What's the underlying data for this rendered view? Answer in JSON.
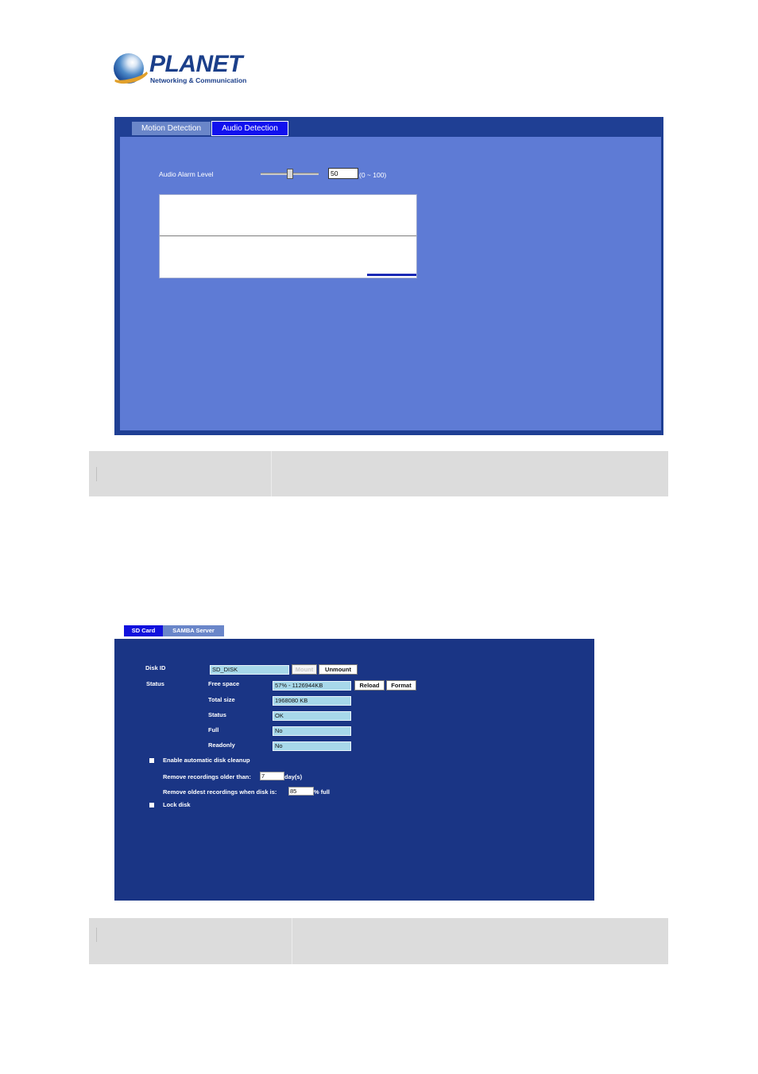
{
  "logo": {
    "brand": "PLANET",
    "tagline": "Networking & Communication"
  },
  "audio_panel": {
    "tabs": [
      {
        "label": "Motion Detection",
        "selected": false
      },
      {
        "label": "Audio Detection",
        "selected": true
      }
    ],
    "alarm_level_label": "Audio Alarm Level",
    "alarm_level_value": "50",
    "alarm_level_range": "(0 ~ 100)",
    "slider_fraction": 0.5
  },
  "sd_panel": {
    "tabs": [
      {
        "label": "SD Card",
        "selected": true
      },
      {
        "label": "SAMBA Server",
        "selected": false
      }
    ],
    "disk_id_label": "Disk ID",
    "disk_id_value": "SD_DISK",
    "mount_label": "Mount",
    "unmount_label": "Unmount",
    "status_label": "Status",
    "free_space_label": "Free space",
    "free_space_value": "57% - 1126944KB",
    "reload_label": "Reload",
    "format_label": "Format",
    "total_size_label": "Total size",
    "total_size_value": "1968080 KB",
    "status_field_label": "Status",
    "status_value": "OK",
    "full_label": "Full",
    "full_value": "No",
    "readonly_label": "Readonly",
    "readonly_value": "No",
    "cleanup_label": "Enable automatic disk cleanup",
    "remove_older_label": "Remove recordings older than:",
    "remove_older_value": "7",
    "days_unit": "day(s)",
    "remove_oldest_label": "Remove oldest recordings when disk is:",
    "remove_oldest_value": "85",
    "percent_full_unit": "% full",
    "lock_disk_label": "Lock disk"
  },
  "colors": {
    "audio_panel_outer": "#1f3f94",
    "audio_panel_inner": "#5e7bd5",
    "sd_panel_bg": "#1a3585",
    "selected_tab": "#1111ee",
    "field_bg": "#a7d8ea",
    "table_gray": "#dcdcdc"
  }
}
